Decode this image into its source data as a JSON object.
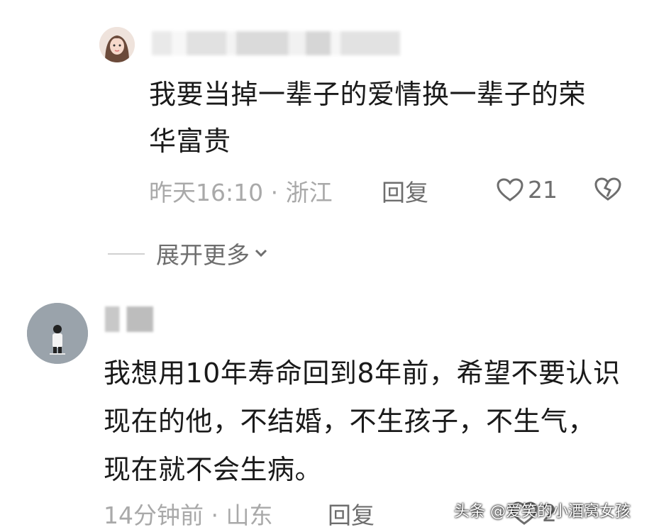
{
  "reply": {
    "text": "我要当掉一辈子的爱情换一辈子的荣华富贵",
    "meta": "昨天16:10 · 浙江",
    "reply_label": "回复",
    "likes": "21"
  },
  "expand_label": "展开更多",
  "comment": {
    "text": "我想用10年寿命回到8年前，希望不要认识现在的他，不结婚，不生孩子，不生气，现在就不会生病。",
    "meta": "14分钟前 · 山东",
    "reply_label": "回复",
    "likes": "2"
  },
  "watermark": "头条 @爱笑的小酒窝女孩",
  "icons": {
    "like": "heart-outline-icon",
    "dislike": "broken-heart-icon",
    "expand": "chevron-down-icon"
  }
}
